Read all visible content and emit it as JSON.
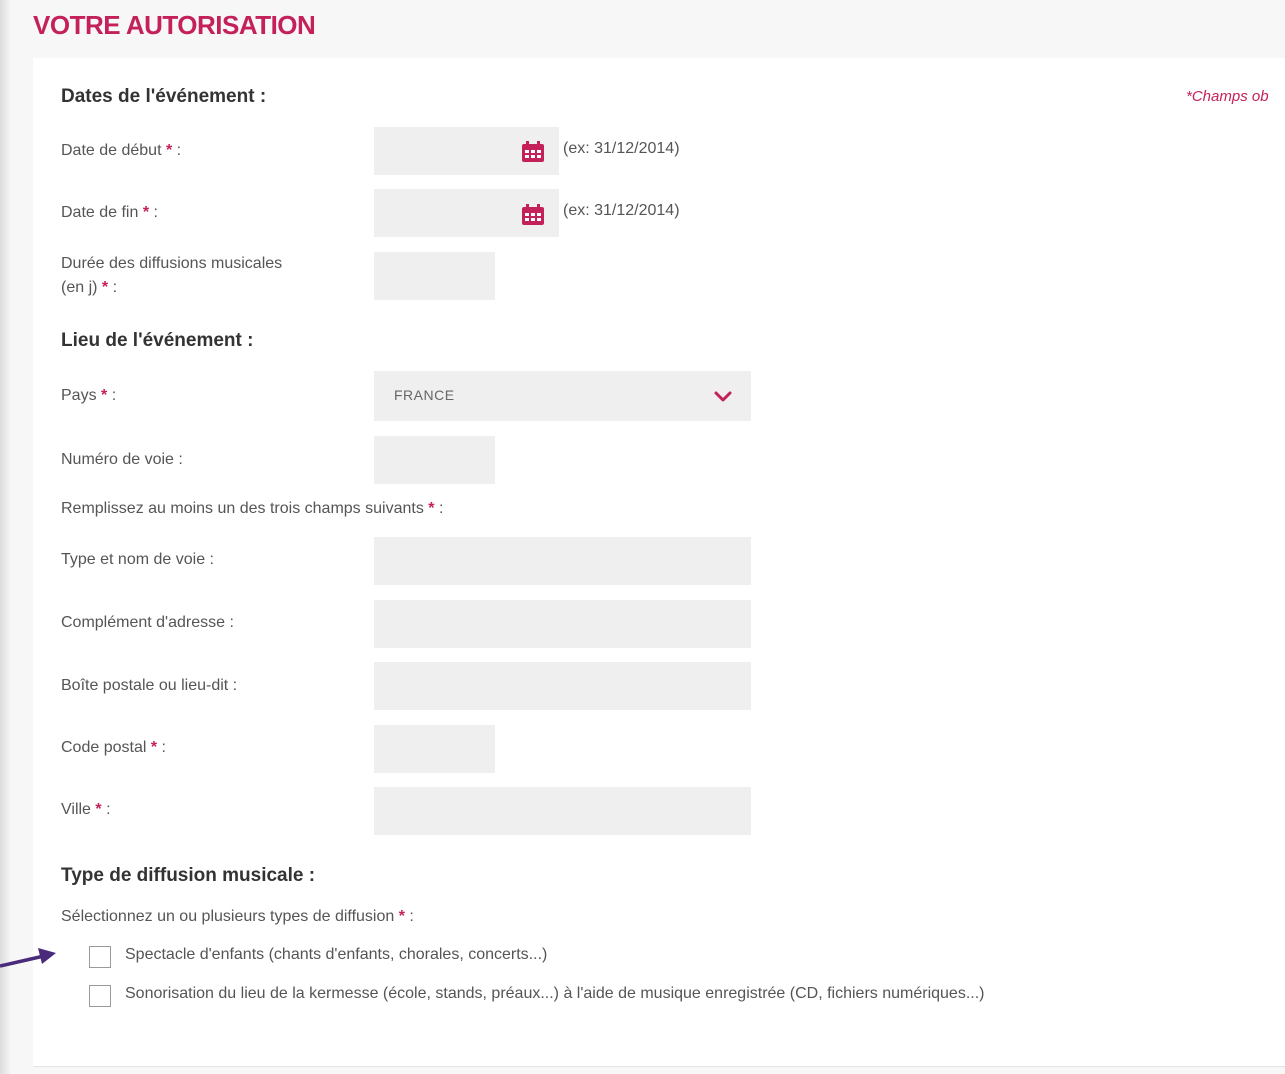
{
  "header": {
    "title": "VOTRE AUTORISATION"
  },
  "required_note": "*Champs ob",
  "dates_section": {
    "title": "Dates de l'événement :",
    "start_date": {
      "label": "Date de début",
      "value": "",
      "hint": "(ex: 31/12/2014)"
    },
    "end_date": {
      "label": "Date de fin",
      "value": "",
      "hint": "(ex: 31/12/2014)"
    },
    "duration": {
      "label_line1": "Durée des diffusions musicales",
      "label_line2": "(en j)",
      "value": ""
    }
  },
  "location_section": {
    "title": "Lieu de l'événement :",
    "country": {
      "label": "Pays",
      "selected": "FRANCE"
    },
    "street_number": {
      "label": "Numéro de voie :",
      "value": ""
    },
    "fill_one_instruction": "Remplissez au moins un des trois champs suivants",
    "street_name": {
      "label": "Type et nom de voie :",
      "value": ""
    },
    "address_complement": {
      "label": "Complément d'adresse :",
      "value": ""
    },
    "po_box": {
      "label": "Boîte postale ou lieu-dit :",
      "value": ""
    },
    "postal_code": {
      "label": "Code postal",
      "value": ""
    },
    "city": {
      "label": "Ville",
      "value": ""
    }
  },
  "diffusion_section": {
    "title": "Type de diffusion musicale :",
    "instruction": "Sélectionnez un ou plusieurs types de diffusion",
    "options": [
      {
        "label": "Spectacle d'enfants (chants d'enfants, chorales, concerts...)",
        "checked": false
      },
      {
        "label": "Sonorisation du lieu de la kermesse (école, stands, préaux...) à l'aide de musique enregistrée (CD, fichiers numériques...)",
        "checked": false
      }
    ]
  },
  "colors": {
    "accent": "#c4215b",
    "arrow": "#4a2a7a",
    "field_bg": "#efefef"
  },
  "icons": [
    "calendar-icon",
    "chevron-down-icon",
    "checkbox",
    "arrow-pointer-icon"
  ]
}
